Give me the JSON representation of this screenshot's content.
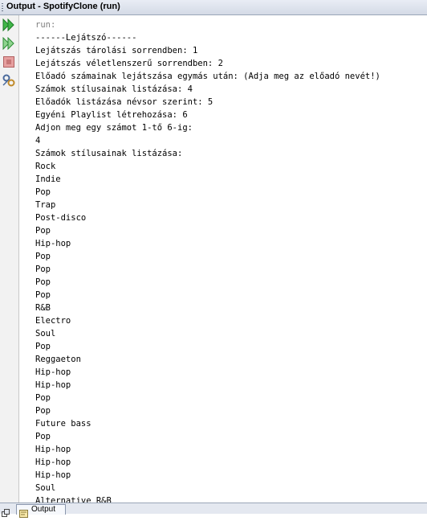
{
  "window": {
    "title": "Output - SpotifyClone (run)"
  },
  "toolbar": {
    "buttons": [
      {
        "name": "rerun-icon",
        "color": "#3cb043"
      },
      {
        "name": "rerun-with-params-icon",
        "color": "#3cb043"
      },
      {
        "name": "stop-icon",
        "color": "#c46060"
      },
      {
        "name": "settings-icon",
        "color": "#5b6f96"
      }
    ]
  },
  "console": {
    "lines": [
      "run:",
      "------Lejátszó------",
      "Lejátszás tárolási sorrendben: 1",
      "Lejátszás véletlenszerű sorrendben: 2",
      "Előadó számainak lejátszása egymás után: (Adja meg az előadó nevét!)",
      "Számok stílusainak listázása: 4",
      "Előadók listázása névsor szerint: 5",
      "Egyéni Playlist létrehozása: 6",
      "Adjon meg egy számot 1-tő 6-ig:",
      "4",
      "Számok stílusainak listázása:",
      "Rock",
      "Indie",
      "Pop",
      "Trap",
      "Post-disco",
      "Pop",
      "Hip-hop",
      "Pop",
      "Pop",
      "Pop",
      "Pop",
      "R&B",
      "Electro",
      "Soul",
      "Pop",
      "Reggaeton",
      "Hip-hop",
      "Hip-hop",
      "Pop",
      "Pop",
      "Future bass",
      "Pop",
      "Hip-hop",
      "Hip-hop",
      "Hip-hop",
      "Soul",
      "Alternative R&B"
    ]
  },
  "statusbar": {
    "tab_label": "Output"
  }
}
